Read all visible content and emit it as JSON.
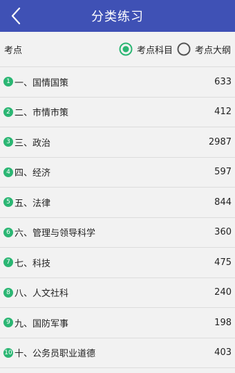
{
  "header": {
    "title": "分类练习"
  },
  "filter": {
    "label": "考点",
    "options": [
      {
        "label": "考点科目",
        "selected": true
      },
      {
        "label": "考点大纲",
        "selected": false
      }
    ]
  },
  "items": [
    {
      "num": "1",
      "name": "一、国情国策",
      "count": "633"
    },
    {
      "num": "2",
      "name": "二、市情市策",
      "count": "412"
    },
    {
      "num": "3",
      "name": "三、政治",
      "count": "2987"
    },
    {
      "num": "4",
      "name": "四、经济",
      "count": "597"
    },
    {
      "num": "5",
      "name": "五、法律",
      "count": "844"
    },
    {
      "num": "6",
      "name": "六、管理与领导科学",
      "count": "360"
    },
    {
      "num": "7",
      "name": "七、科技",
      "count": "475"
    },
    {
      "num": "8",
      "name": "八、人文社科",
      "count": "240"
    },
    {
      "num": "9",
      "name": "九、国防军事",
      "count": "198"
    },
    {
      "num": "10",
      "name": "十、公务员职业道德",
      "count": "403"
    }
  ],
  "colors": {
    "header": "#3f51b5",
    "accent": "#2bb673"
  }
}
